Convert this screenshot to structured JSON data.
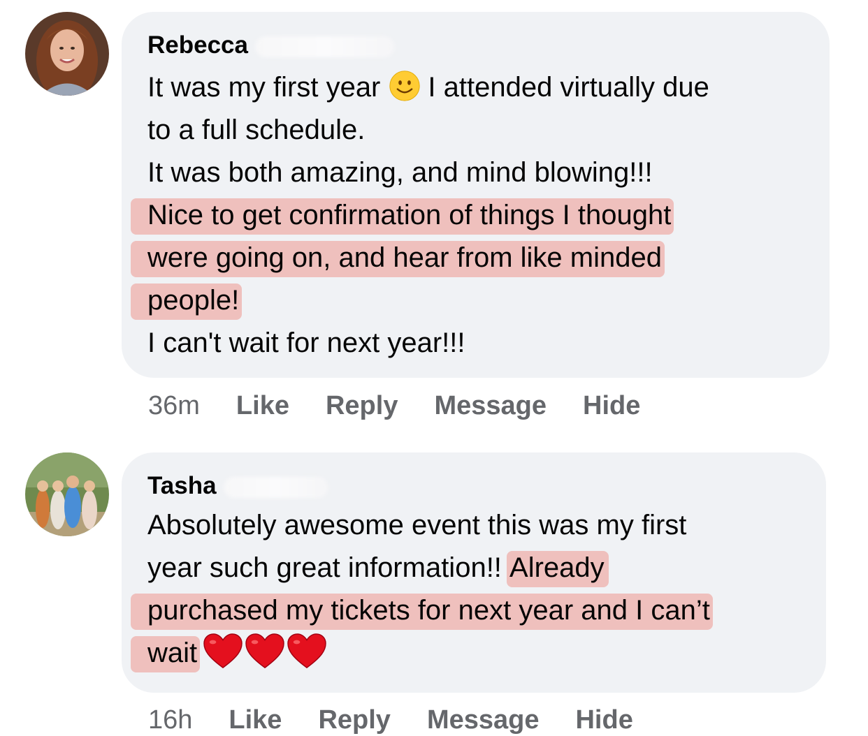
{
  "comments": [
    {
      "author": "Rebecca",
      "lines": {
        "l1a": "It was my first year",
        "l1b": "I attended virtually due",
        "l2": "to a full schedule.",
        "l3": "It was both amazing, and mind blowing!!!",
        "l4": "Nice to get confirmation of things I thought",
        "l5": "were going on, and hear from like minded",
        "l6": "people!",
        "l7": "I can't wait for next year!!!"
      },
      "emoji": "slightly-smiling-face-icon",
      "time": "36m",
      "actions": {
        "like": "Like",
        "reply": "Reply",
        "message": "Message",
        "hide": "Hide"
      }
    },
    {
      "author": "Tasha",
      "lines": {
        "l1": "Absolutely awesome event this was my first",
        "l2a": "year such great information!! ",
        "l2b": "Already",
        "l3": "purchased my tickets for next year and I can’t",
        "l4": "wait"
      },
      "emoji": "red-heart-icon",
      "time": "16h",
      "actions": {
        "like": "Like",
        "reply": "Reply",
        "message": "Message",
        "hide": "Hide"
      }
    }
  ],
  "colors": {
    "bubble": "#f0f2f5",
    "highlight": "#ec6e60",
    "meta_text": "#65676b",
    "heart": "#e4101e"
  }
}
